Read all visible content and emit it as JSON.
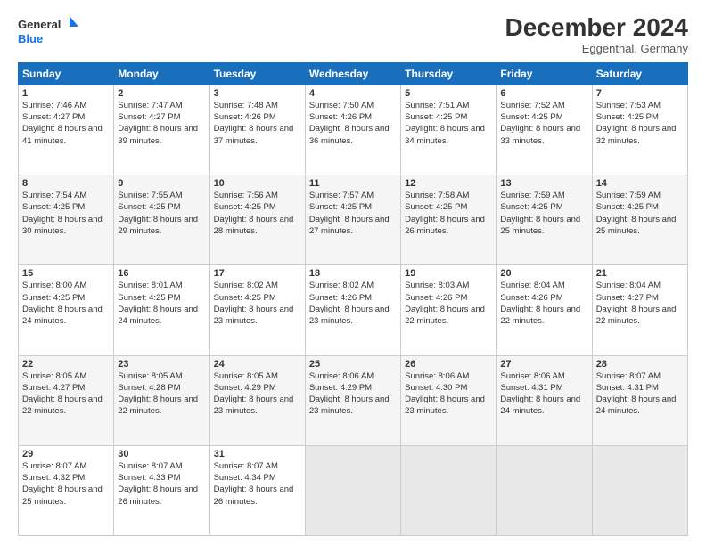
{
  "logo": {
    "line1": "General",
    "line2": "Blue"
  },
  "title": "December 2024",
  "subtitle": "Eggenthal, Germany",
  "headers": [
    "Sunday",
    "Monday",
    "Tuesday",
    "Wednesday",
    "Thursday",
    "Friday",
    "Saturday"
  ],
  "weeks": [
    [
      {
        "day": "1",
        "sunrise": "7:46 AM",
        "sunset": "4:27 PM",
        "daylight": "8 hours and 41 minutes."
      },
      {
        "day": "2",
        "sunrise": "7:47 AM",
        "sunset": "4:27 PM",
        "daylight": "8 hours and 39 minutes."
      },
      {
        "day": "3",
        "sunrise": "7:48 AM",
        "sunset": "4:26 PM",
        "daylight": "8 hours and 37 minutes."
      },
      {
        "day": "4",
        "sunrise": "7:50 AM",
        "sunset": "4:26 PM",
        "daylight": "8 hours and 36 minutes."
      },
      {
        "day": "5",
        "sunrise": "7:51 AM",
        "sunset": "4:25 PM",
        "daylight": "8 hours and 34 minutes."
      },
      {
        "day": "6",
        "sunrise": "7:52 AM",
        "sunset": "4:25 PM",
        "daylight": "8 hours and 33 minutes."
      },
      {
        "day": "7",
        "sunrise": "7:53 AM",
        "sunset": "4:25 PM",
        "daylight": "8 hours and 32 minutes."
      }
    ],
    [
      {
        "day": "8",
        "sunrise": "7:54 AM",
        "sunset": "4:25 PM",
        "daylight": "8 hours and 30 minutes."
      },
      {
        "day": "9",
        "sunrise": "7:55 AM",
        "sunset": "4:25 PM",
        "daylight": "8 hours and 29 minutes."
      },
      {
        "day": "10",
        "sunrise": "7:56 AM",
        "sunset": "4:25 PM",
        "daylight": "8 hours and 28 minutes."
      },
      {
        "day": "11",
        "sunrise": "7:57 AM",
        "sunset": "4:25 PM",
        "daylight": "8 hours and 27 minutes."
      },
      {
        "day": "12",
        "sunrise": "7:58 AM",
        "sunset": "4:25 PM",
        "daylight": "8 hours and 26 minutes."
      },
      {
        "day": "13",
        "sunrise": "7:59 AM",
        "sunset": "4:25 PM",
        "daylight": "8 hours and 25 minutes."
      },
      {
        "day": "14",
        "sunrise": "7:59 AM",
        "sunset": "4:25 PM",
        "daylight": "8 hours and 25 minutes."
      }
    ],
    [
      {
        "day": "15",
        "sunrise": "8:00 AM",
        "sunset": "4:25 PM",
        "daylight": "8 hours and 24 minutes."
      },
      {
        "day": "16",
        "sunrise": "8:01 AM",
        "sunset": "4:25 PM",
        "daylight": "8 hours and 24 minutes."
      },
      {
        "day": "17",
        "sunrise": "8:02 AM",
        "sunset": "4:25 PM",
        "daylight": "8 hours and 23 minutes."
      },
      {
        "day": "18",
        "sunrise": "8:02 AM",
        "sunset": "4:26 PM",
        "daylight": "8 hours and 23 minutes."
      },
      {
        "day": "19",
        "sunrise": "8:03 AM",
        "sunset": "4:26 PM",
        "daylight": "8 hours and 22 minutes."
      },
      {
        "day": "20",
        "sunrise": "8:04 AM",
        "sunset": "4:26 PM",
        "daylight": "8 hours and 22 minutes."
      },
      {
        "day": "21",
        "sunrise": "8:04 AM",
        "sunset": "4:27 PM",
        "daylight": "8 hours and 22 minutes."
      }
    ],
    [
      {
        "day": "22",
        "sunrise": "8:05 AM",
        "sunset": "4:27 PM",
        "daylight": "8 hours and 22 minutes."
      },
      {
        "day": "23",
        "sunrise": "8:05 AM",
        "sunset": "4:28 PM",
        "daylight": "8 hours and 22 minutes."
      },
      {
        "day": "24",
        "sunrise": "8:05 AM",
        "sunset": "4:29 PM",
        "daylight": "8 hours and 23 minutes."
      },
      {
        "day": "25",
        "sunrise": "8:06 AM",
        "sunset": "4:29 PM",
        "daylight": "8 hours and 23 minutes."
      },
      {
        "day": "26",
        "sunrise": "8:06 AM",
        "sunset": "4:30 PM",
        "daylight": "8 hours and 23 minutes."
      },
      {
        "day": "27",
        "sunrise": "8:06 AM",
        "sunset": "4:31 PM",
        "daylight": "8 hours and 24 minutes."
      },
      {
        "day": "28",
        "sunrise": "8:07 AM",
        "sunset": "4:31 PM",
        "daylight": "8 hours and 24 minutes."
      }
    ],
    [
      {
        "day": "29",
        "sunrise": "8:07 AM",
        "sunset": "4:32 PM",
        "daylight": "8 hours and 25 minutes."
      },
      {
        "day": "30",
        "sunrise": "8:07 AM",
        "sunset": "4:33 PM",
        "daylight": "8 hours and 26 minutes."
      },
      {
        "day": "31",
        "sunrise": "8:07 AM",
        "sunset": "4:34 PM",
        "daylight": "8 hours and 26 minutes."
      },
      null,
      null,
      null,
      null
    ]
  ]
}
